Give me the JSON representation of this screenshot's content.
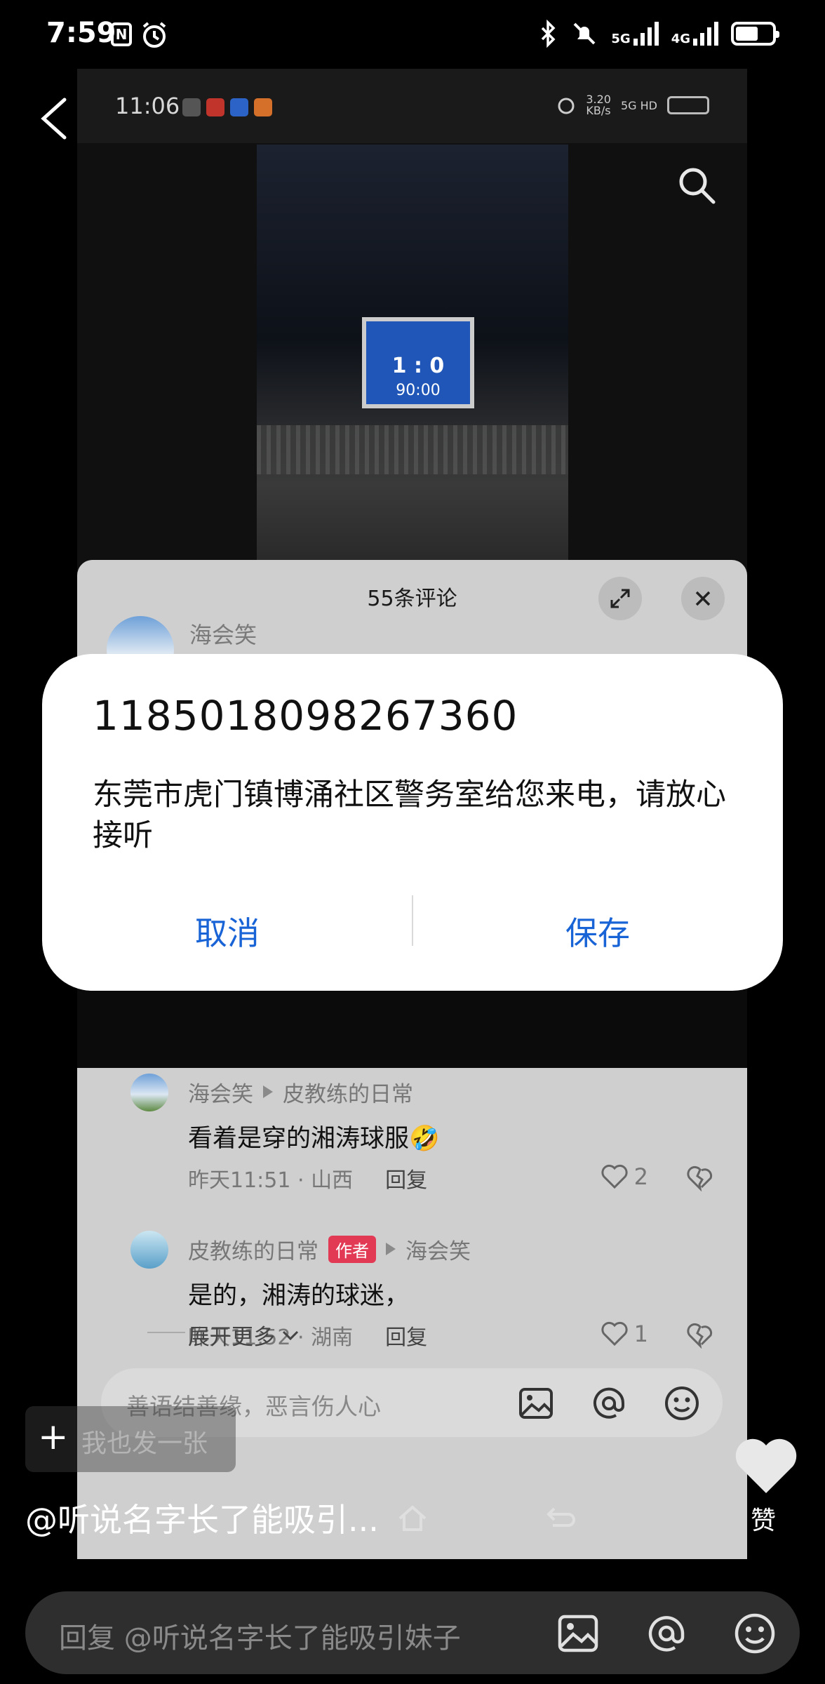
{
  "status_bar": {
    "time": "7:59",
    "nfc_label": "N",
    "net1": "5G",
    "net2": "4G"
  },
  "inner": {
    "status_time": "11:06",
    "net_speed": "3.20\nKB/s",
    "net_tag": "5G HD",
    "scoreboard": {
      "score": "1 : 0",
      "time": "90:00"
    }
  },
  "sheet": {
    "title": "55条评论",
    "top_commenter": "海会笑",
    "replies": [
      {
        "user": "海会笑",
        "author_badge": "",
        "reply_to": "皮教练的日常",
        "text": "看着是穿的湘涛球服🤣",
        "time_location": "昨天11:51 · 山西",
        "reply_label": "回复",
        "likes": "2"
      },
      {
        "user": "皮教练的日常",
        "author_badge": "作者",
        "reply_to": "海会笑",
        "text": "是的，湘涛的球迷，",
        "time_location": "昨天11:52 · 湖南",
        "reply_label": "回复",
        "likes": "1"
      }
    ],
    "expand_more": "展开更多",
    "input_placeholder": "善语结善缘，恶言伤人心"
  },
  "overlay": {
    "plus_label": "我也发一张",
    "caption": "@听说名字长了能吸引...",
    "like_label": "赞"
  },
  "bottom_input": {
    "placeholder": "回复 @听说名字长了能吸引妹子"
  },
  "dialog": {
    "number": "1185018098267360",
    "message": "东莞市虎门镇博涌社区警务室给您来电，请放心接听",
    "cancel": "取消",
    "save": "保存"
  },
  "colors": {
    "accent_blue": "#1863d6",
    "author_badge": "#e23a55"
  }
}
